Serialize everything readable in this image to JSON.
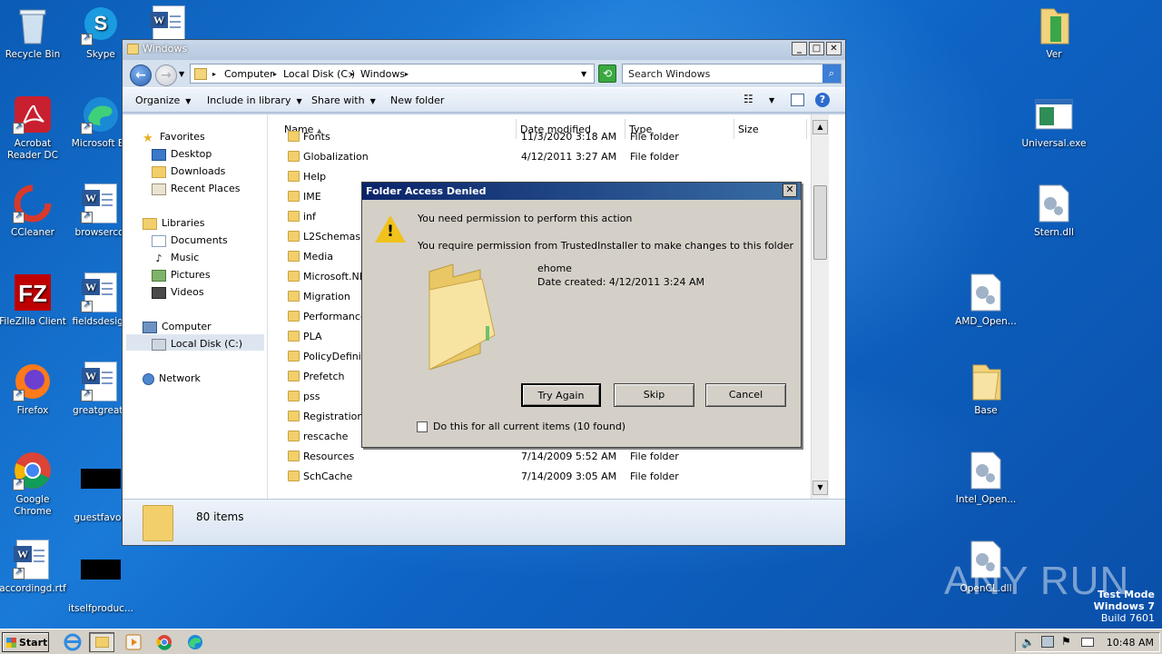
{
  "desktop": {
    "icons_left": [
      {
        "label": "Recycle Bin",
        "icon": "recycle-bin-icon"
      },
      {
        "label": "Skype",
        "icon": "skype-icon"
      },
      {
        "label": "Acrobat Reader DC",
        "icon": "acrobat-icon"
      },
      {
        "label": "Microsoft Ed",
        "icon": "edge-icon"
      },
      {
        "label": "CCleaner",
        "icon": "ccleaner-icon"
      },
      {
        "label": "browsercol",
        "icon": "word-doc-icon"
      },
      {
        "label": "FileZilla Client",
        "icon": "filezilla-icon"
      },
      {
        "label": "fieldsdesign",
        "icon": "word-doc-icon"
      },
      {
        "label": "Firefox",
        "icon": "firefox-icon"
      },
      {
        "label": "greatgreate",
        "icon": "word-doc-icon"
      },
      {
        "label": "Google Chrome",
        "icon": "chrome-icon"
      },
      {
        "label": "guestfavori",
        "icon": "black-file-icon"
      },
      {
        "label": "accordingd.rtf",
        "icon": "word-doc-icon"
      },
      {
        "label": "itselfproduc...",
        "icon": "black-file-icon"
      }
    ],
    "icons_right": [
      {
        "label": "Ver",
        "icon": "folder-icon"
      },
      {
        "label": "Universal.exe",
        "icon": "exe-icon"
      },
      {
        "label": "Stern.dll",
        "icon": "dll-icon"
      },
      {
        "label": "AMD_Open...",
        "icon": "dll-icon"
      },
      {
        "label": "Base",
        "icon": "folder-icon"
      },
      {
        "label": "Intel_Open...",
        "icon": "dll-icon"
      },
      {
        "label": "OpenCL.dll",
        "icon": "dll-icon"
      }
    ],
    "watermark": {
      "brand": "ANY RUN",
      "mode": "Test Mode",
      "os": "Windows 7",
      "build": "Build 7601"
    }
  },
  "explorer": {
    "title": "Windows",
    "breadcrumb": [
      "Computer",
      "Local Disk (C:)",
      "Windows"
    ],
    "search_placeholder": "Search Windows",
    "toolbar": {
      "organize": "Organize",
      "include": "Include in library",
      "share": "Share with",
      "new_folder": "New folder"
    },
    "nav": {
      "favorites": "Favorites",
      "fav_items": [
        "Desktop",
        "Downloads",
        "Recent Places"
      ],
      "libraries": "Libraries",
      "lib_items": [
        "Documents",
        "Music",
        "Pictures",
        "Videos"
      ],
      "computer": "Computer",
      "computer_items": [
        "Local Disk (C:)"
      ],
      "network": "Network"
    },
    "columns": [
      "Name",
      "Date modified",
      "Type",
      "Size"
    ],
    "rows": [
      {
        "name": "Fonts",
        "date": "11/3/2020 3:18 AM",
        "type": "File folder"
      },
      {
        "name": "Globalization",
        "date": "4/12/2011 3:27 AM",
        "type": "File folder"
      },
      {
        "name": "Help",
        "date": "",
        "type": ""
      },
      {
        "name": "IME",
        "date": "",
        "type": ""
      },
      {
        "name": "inf",
        "date": "",
        "type": ""
      },
      {
        "name": "L2Schemas",
        "date": "",
        "type": ""
      },
      {
        "name": "Media",
        "date": "",
        "type": ""
      },
      {
        "name": "Microsoft.NE",
        "date": "",
        "type": ""
      },
      {
        "name": "Migration",
        "date": "",
        "type": ""
      },
      {
        "name": "Performance",
        "date": "",
        "type": ""
      },
      {
        "name": "PLA",
        "date": "",
        "type": ""
      },
      {
        "name": "PolicyDefiniti",
        "date": "",
        "type": ""
      },
      {
        "name": "Prefetch",
        "date": "",
        "type": ""
      },
      {
        "name": "pss",
        "date": "",
        "type": ""
      },
      {
        "name": "Registration",
        "date": "",
        "type": ""
      },
      {
        "name": "rescache",
        "date": "",
        "type": ""
      },
      {
        "name": "Resources",
        "date": "7/14/2009 5:52 AM",
        "type": "File folder"
      },
      {
        "name": "SchCache",
        "date": "7/14/2009 3:05 AM",
        "type": "File folder"
      }
    ],
    "status": "80 items"
  },
  "dialog": {
    "title": "Folder Access Denied",
    "line1": "You need permission to perform this action",
    "line2": "You require permission from TrustedInstaller to make changes to this folder",
    "folder_name": "ehome",
    "date_created": "Date created: 4/12/2011 3:24 AM",
    "try_again": "Try Again",
    "skip": "Skip",
    "cancel": "Cancel",
    "checkbox_label": "Do this for all current items (10 found)"
  },
  "taskbar": {
    "start": "Start",
    "time": "10:48 AM"
  }
}
